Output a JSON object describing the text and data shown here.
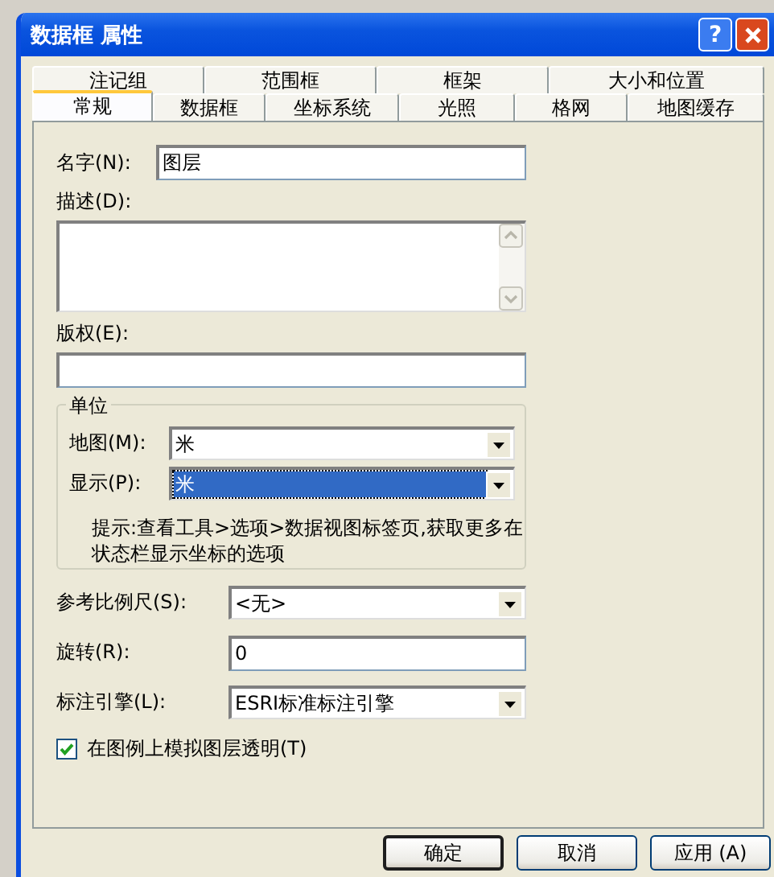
{
  "window": {
    "title": "数据框 属性",
    "help_button": "?"
  },
  "tab_rows": [
    [
      {
        "label": "注记组",
        "selected": false
      },
      {
        "label": "范围框",
        "selected": false
      },
      {
        "label": "框架",
        "selected": false
      },
      {
        "label": "大小和位置",
        "selected": false
      }
    ],
    [
      {
        "label": "常规",
        "selected": true
      },
      {
        "label": "数据框",
        "selected": false
      },
      {
        "label": "坐标系统",
        "selected": false
      },
      {
        "label": "光照",
        "selected": false
      },
      {
        "label": "格网",
        "selected": false
      },
      {
        "label": "地图缓存",
        "selected": false
      }
    ]
  ],
  "general": {
    "name": {
      "label": "名字(N):",
      "value": "图层"
    },
    "description": {
      "label": "描述(D):"
    },
    "copyright": {
      "label": "版权(E):"
    },
    "units": {
      "title": "单位",
      "rows": [
        {
          "label": "地图(M):",
          "value": "米",
          "focused": false
        },
        {
          "label": "显示(P):",
          "value": "米",
          "focused": true
        }
      ],
      "hint": "提示:查看工具>选项>数据视图标签页,获取更多在状态栏显示坐标的选项"
    },
    "settings": [
      {
        "kind": "combo",
        "label": "参考比例尺(S):",
        "value": "<无>"
      },
      {
        "kind": "text",
        "label": "旋转(R):",
        "value": "0"
      },
      {
        "kind": "combo",
        "label": "标注引擎(L):",
        "value": "ESRI标准标注引擎"
      }
    ],
    "simulate_transparency": {
      "label": "在图例上模拟图层透明(T)",
      "checked": true
    }
  },
  "buttons": [
    {
      "label": "确定",
      "default": true
    },
    {
      "label": "取消",
      "default": false
    },
    {
      "label": "应用 (A)",
      "default": false
    }
  ]
}
